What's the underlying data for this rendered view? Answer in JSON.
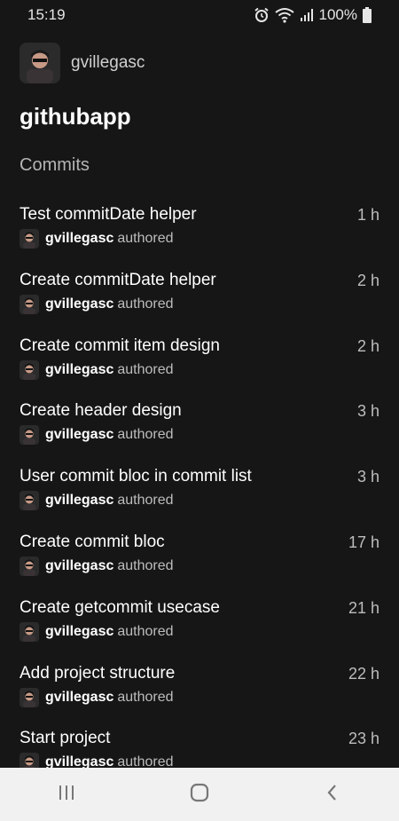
{
  "status_bar": {
    "time": "15:19",
    "battery": "100%",
    "icons": [
      "alarm-icon",
      "wifi-icon",
      "signal-icon",
      "battery-icon"
    ]
  },
  "profile": {
    "username": "gvillegasc"
  },
  "repo": {
    "name": "githubapp"
  },
  "section": {
    "title": "Commits"
  },
  "commits": [
    {
      "message": "Test commitDate helper",
      "time": "1 h",
      "author": "gvillegasc",
      "action": "authored"
    },
    {
      "message": "Create commitDate helper",
      "time": "2 h",
      "author": "gvillegasc",
      "action": "authored"
    },
    {
      "message": "Create commit item design",
      "time": "2 h",
      "author": "gvillegasc",
      "action": "authored"
    },
    {
      "message": "Create header design",
      "time": "3 h",
      "author": "gvillegasc",
      "action": "authored"
    },
    {
      "message": "User commit bloc in commit list",
      "time": "3 h",
      "author": "gvillegasc",
      "action": "authored"
    },
    {
      "message": "Create commit bloc",
      "time": "17 h",
      "author": "gvillegasc",
      "action": "authored"
    },
    {
      "message": "Create getcommit usecase",
      "time": "21 h",
      "author": "gvillegasc",
      "action": "authored"
    },
    {
      "message": "Add project structure",
      "time": "22 h",
      "author": "gvillegasc",
      "action": "authored"
    },
    {
      "message": "Start project",
      "time": "23 h",
      "author": "gvillegasc",
      "action": "authored"
    }
  ],
  "nav": {
    "icons": [
      "recent-apps-icon",
      "home-icon",
      "back-icon"
    ]
  },
  "colors": {
    "background": "#161616",
    "nav_background": "#f1f1f1",
    "text": "#ffffff",
    "muted": "#bdbdbd"
  }
}
